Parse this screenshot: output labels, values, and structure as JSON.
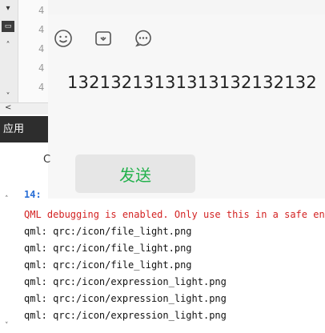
{
  "editor": {
    "line_numbers": [
      "4",
      "4",
      "4",
      "4",
      "4"
    ]
  },
  "chat": {
    "toolbar_icons": [
      "emoji-icon",
      "folder-icon",
      "chat-bubble-icon"
    ],
    "message_text": "13213213131313132132132",
    "send_label": "发送",
    "send_color": "#22b14c"
  },
  "side": {
    "app_tab_label": "应用",
    "c_label": "C",
    "time_label": "14:"
  },
  "console": {
    "lines": [
      {
        "text": "QML debugging is enabled. Only use this in a safe environment.",
        "color": "#d32222"
      },
      {
        "text": "qml: qrc:/icon/file_light.png"
      },
      {
        "text": "qml: qrc:/icon/file_light.png"
      },
      {
        "text": "qml: qrc:/icon/file_light.png"
      },
      {
        "text": "qml: qrc:/icon/expression_light.png"
      },
      {
        "text": "qml: qrc:/icon/expression_light.png"
      },
      {
        "text": "qml: qrc:/icon/expression_light.png"
      }
    ]
  }
}
